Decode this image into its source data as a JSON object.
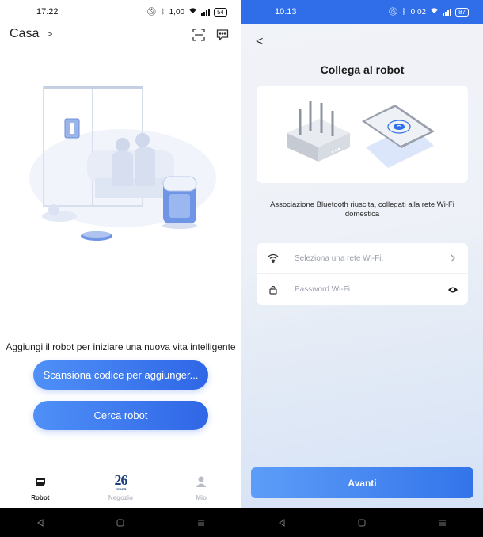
{
  "left": {
    "status": {
      "time": "17:22",
      "network_speed": "1,00",
      "battery": "54"
    },
    "header": {
      "title": "Casa",
      "chevron": ">"
    },
    "prompt": "Aggiungi il robot per iniziare una nuova vita intelligente",
    "scan_button": "Scansiona codice per aggiunger...",
    "search_button": "Cerca robot",
    "tabs": [
      {
        "label": "Robot",
        "icon": "robot-icon"
      },
      {
        "label": "Negozio",
        "icon": "anniversary-26-icon",
        "icon_text": "26",
        "icon_subtext": "YEARS"
      },
      {
        "label": "Mio",
        "icon": "person-icon"
      }
    ]
  },
  "right": {
    "status": {
      "time": "10:13",
      "network_speed": "0,02",
      "battery": "87"
    },
    "back": "<",
    "title": "Collega al robot",
    "message": "Associazione Bluetooth riuscita, collegati alla rete Wi-Fi domestica",
    "wifi_placeholder": "Seleziona una rete Wi-Fi.",
    "password_placeholder": "Password Wi-Fi",
    "next_button": "Avanti"
  },
  "colors": {
    "primary": "#2f6ee8",
    "button_gradient_start": "#4f90f7",
    "button_gradient_end": "#2f66e6",
    "tab_active": "#1a1a1a",
    "tab_inactive": "#b8bcc6"
  }
}
